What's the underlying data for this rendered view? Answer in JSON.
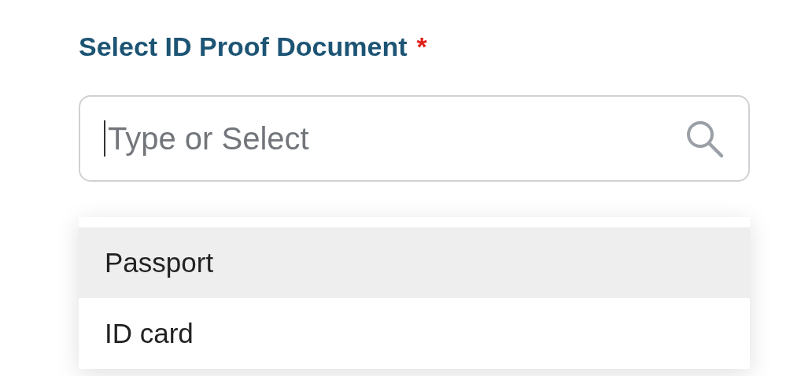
{
  "field": {
    "label": "Select ID Proof Document",
    "required_mark": "*",
    "placeholder": "Type or Select"
  },
  "options": [
    {
      "label": "Passport",
      "selected": true
    },
    {
      "label": "ID card",
      "selected": false
    }
  ]
}
